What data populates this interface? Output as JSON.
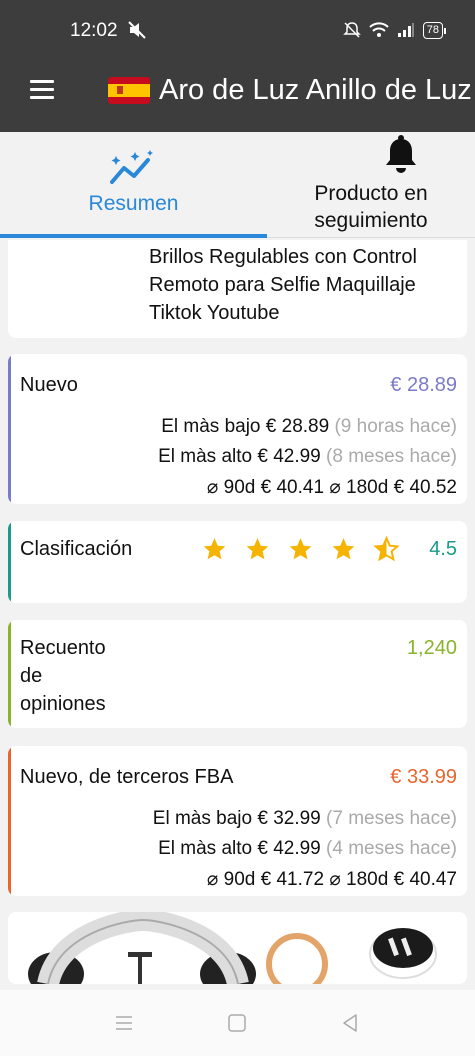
{
  "status_bar": {
    "time": "12:02",
    "battery": "78"
  },
  "app_bar": {
    "title": "Aro de Luz Anillo de Luz"
  },
  "tabs": [
    {
      "label": "Resumen",
      "active": true
    },
    {
      "label": "Producto en seguimiento",
      "active": false
    }
  ],
  "description": {
    "text": "Brillos Regulables con Control Remoto para Selfie Maquillaje Tiktok Youtube"
  },
  "nuevo": {
    "name": "Nuevo",
    "price": "€ 28.89",
    "color": "#7b7bc8",
    "lowest_label": "El màs bajo",
    "lowest_value": "€ 28.89",
    "lowest_time": "(9 horas hace)",
    "highest_label": "El màs alto",
    "highest_value": "€ 42.99",
    "highest_time": "(8 meses hace)",
    "avg90_label": "⌀ 90d",
    "avg90_value": "€ 40.41",
    "avg180_label": "⌀ 180d",
    "avg180_value": "€ 40.52"
  },
  "rating": {
    "name": "Clasificación",
    "value": "4.5",
    "stars": 4.5,
    "color": "#1a9a8a"
  },
  "reviews": {
    "name": "Recuento de opiniones",
    "value": "1,240",
    "color": "#8ab32a"
  },
  "fba": {
    "name": "Nuevo, de terceros FBA",
    "price": "€ 33.99",
    "color": "#e8662e",
    "lowest_label": "El màs bajo",
    "lowest_value": "€ 32.99",
    "lowest_time": "(7 meses hace)",
    "highest_label": "El màs alto",
    "highest_value": "€ 42.99",
    "highest_time": "(4 meses hace)",
    "avg90_label": "⌀ 90d",
    "avg90_value": "€ 41.72",
    "avg180_label": "⌀ 180d",
    "avg180_value": "€ 40.47"
  },
  "icons": {
    "menu": "hamburger-menu-icon",
    "flag": "spain-flag-icon",
    "summary": "trending-sparkle-icon",
    "bell": "bell-icon",
    "nav": [
      "recents-icon",
      "home-icon",
      "back-icon"
    ]
  }
}
